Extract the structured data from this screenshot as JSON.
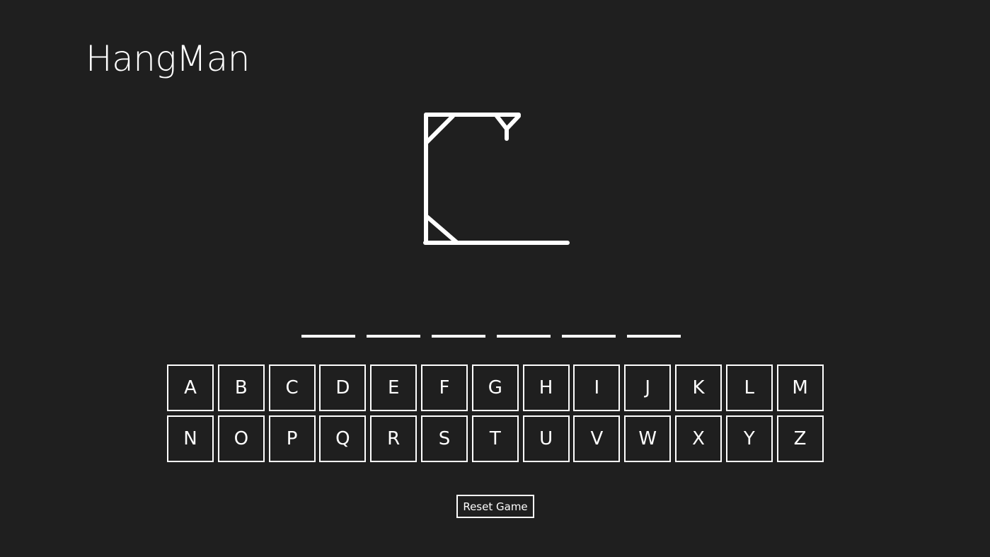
{
  "app": {
    "title": "HangMan"
  },
  "word": {
    "letters": [
      "",
      "",
      "",
      "",
      "",
      ""
    ]
  },
  "keyboard": {
    "rows": [
      [
        "A",
        "B",
        "C",
        "D",
        "E",
        "F",
        "G",
        "H",
        "I",
        "J",
        "K",
        "L",
        "M"
      ],
      [
        "N",
        "O",
        "P",
        "Q",
        "R",
        "S",
        "T",
        "U",
        "V",
        "W",
        "X",
        "Y",
        "Z"
      ]
    ]
  },
  "controls": {
    "reset_label": "Reset Game"
  },
  "colors": {
    "background": "#1f1f1f",
    "foreground": "#ffffff"
  }
}
